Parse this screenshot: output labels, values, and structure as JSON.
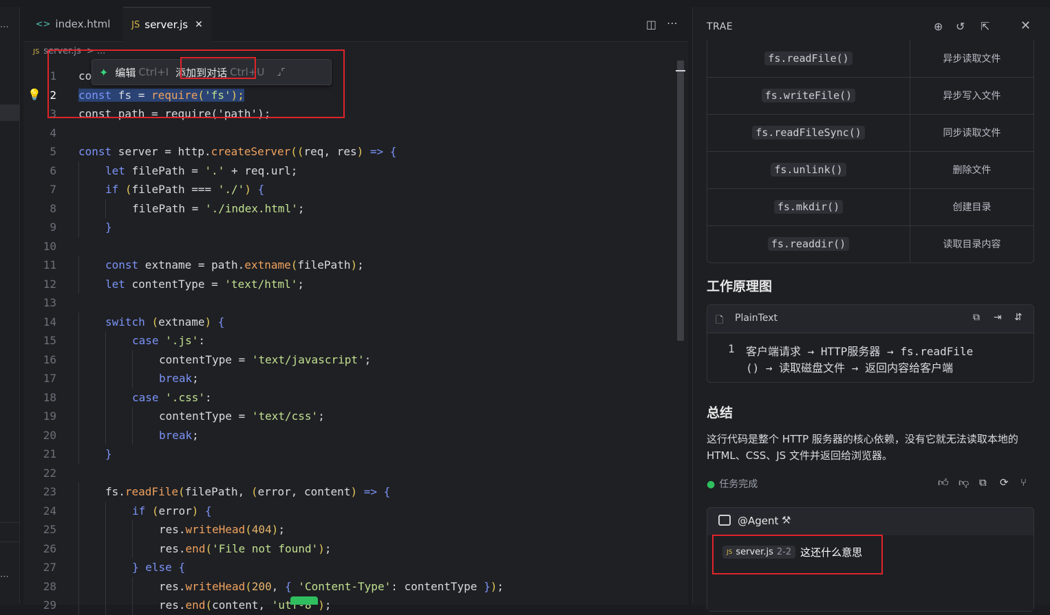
{
  "tabs": [
    {
      "icon": "<>",
      "label": "index.html"
    },
    {
      "icon": "JS",
      "label": "server.js",
      "close": "✕"
    }
  ],
  "breadcrumb": {
    "icon": "JS",
    "file": "server.js",
    "sep": ">",
    "rest": "..."
  },
  "inline_popup": {
    "edit_label": "编辑",
    "edit_shortcut": "Ctrl+I",
    "add_label": "添加到对话",
    "add_shortcut": "Ctrl+U"
  },
  "line_numbers": [
    "1",
    "2",
    "3",
    "4",
    "5",
    "6",
    "7",
    "8",
    "9",
    "10",
    "11",
    "12",
    "13",
    "14",
    "15",
    "16",
    "17",
    "18",
    "19",
    "20",
    "21",
    "22",
    "23",
    "24",
    "25",
    "26",
    "27",
    "28",
    "29"
  ],
  "code_text": {
    "l1": "const http = require('http');",
    "l2a": "const",
    "l2b": " fs",
    "l2c": " = ",
    "l2d": "require",
    "l2e": "(",
    "l2f": "'fs'",
    "l2g": ");",
    "l3": "const path = require('path');"
  },
  "panel": {
    "title": "TRAE",
    "table": [
      {
        "method": "fs.readFile()",
        "desc": "异步读取文件"
      },
      {
        "method": "fs.writeFile()",
        "desc": "异步写入文件"
      },
      {
        "method": "fs.readFileSync()",
        "desc": "同步读取文件"
      },
      {
        "method": "fs.unlink()",
        "desc": "删除文件"
      },
      {
        "method": "fs.mkdir()",
        "desc": "创建目录"
      },
      {
        "method": "fs.readdir()",
        "desc": "读取目录内容"
      }
    ],
    "section1": "工作原理图",
    "codeblock": {
      "lang": "PlainText",
      "line_no": "1",
      "line1": "客户端请求 → HTTP服务器 → fs.readFile",
      "line2": "() → 读取磁盘文件 → 返回内容给客户端"
    },
    "section2": "总结",
    "summary": "这行代码是整个 HTTP 服务器的核心依赖，没有它就无法读取本地的 HTML、CSS、JS 文件并返回给浏览器。",
    "status": "任务完成",
    "input": {
      "agent": "@Agent",
      "ref_icon": "JS",
      "ref_file": "server.js",
      "ref_range": "2-2",
      "question": "这还什么意思"
    }
  }
}
